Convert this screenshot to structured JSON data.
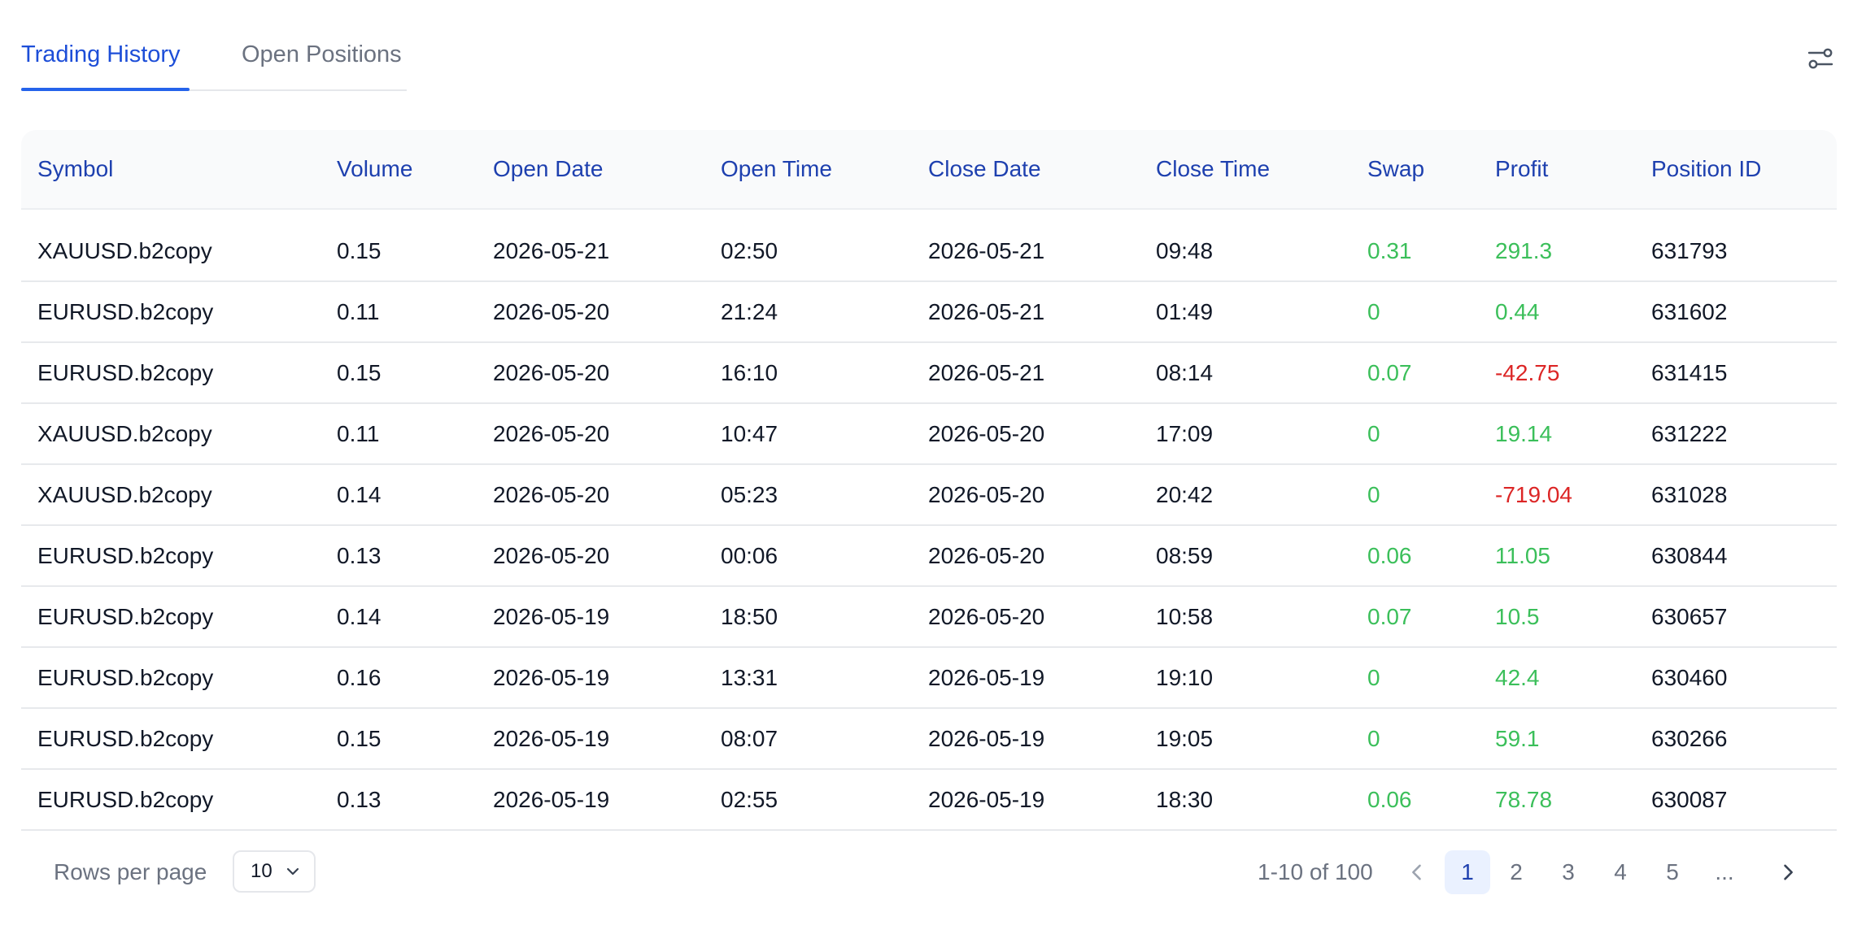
{
  "tabs": [
    {
      "label": "Trading History",
      "active": true
    },
    {
      "label": "Open Positions",
      "active": false
    }
  ],
  "settings_icon": "sliders-settings-icon",
  "table": {
    "headers": [
      "Symbol",
      "Volume",
      "Open Date",
      "Open Time",
      "Close Date",
      "Close Time",
      "Swap",
      "Profit",
      "Position ID"
    ],
    "rows": [
      [
        "XAUUSD.b2copy",
        "0.15",
        "2026-05-21",
        "02:50",
        "2026-05-21",
        "09:48",
        "0.31",
        "291.3",
        "631793"
      ],
      [
        "EURUSD.b2copy",
        "0.11",
        "2026-05-20",
        "21:24",
        "2026-05-21",
        "01:49",
        "0",
        "0.44",
        "631602"
      ],
      [
        "EURUSD.b2copy",
        "0.15",
        "2026-05-20",
        "16:10",
        "2026-05-21",
        "08:14",
        "0.07",
        "-42.75",
        "631415"
      ],
      [
        "XAUUSD.b2copy",
        "0.11",
        "2026-05-20",
        "10:47",
        "2026-05-20",
        "17:09",
        "0",
        "19.14",
        "631222"
      ],
      [
        "XAUUSD.b2copy",
        "0.14",
        "2026-05-20",
        "05:23",
        "2026-05-20",
        "20:42",
        "0",
        "-719.04",
        "631028"
      ],
      [
        "EURUSD.b2copy",
        "0.13",
        "2026-05-20",
        "00:06",
        "2026-05-20",
        "08:59",
        "0.06",
        "11.05",
        "630844"
      ],
      [
        "EURUSD.b2copy",
        "0.14",
        "2026-05-19",
        "18:50",
        "2026-05-20",
        "10:58",
        "0.07",
        "10.5",
        "630657"
      ],
      [
        "EURUSD.b2copy",
        "0.16",
        "2026-05-19",
        "13:31",
        "2026-05-19",
        "19:10",
        "0",
        "42.4",
        "630460"
      ],
      [
        "EURUSD.b2copy",
        "0.15",
        "2026-05-19",
        "08:07",
        "2026-05-19",
        "19:05",
        "0",
        "59.1",
        "630266"
      ],
      [
        "EURUSD.b2copy",
        "0.13",
        "2026-05-19",
        "02:55",
        "2026-05-19",
        "18:30",
        "0.06",
        "78.78",
        "630087"
      ]
    ]
  },
  "footer": {
    "rows_per_page_label": "Rows per page",
    "rows_per_page_value": "10",
    "range_text": "1-10 of 100",
    "pages": [
      "1",
      "2",
      "3",
      "4",
      "5",
      "..."
    ],
    "current_page": "1"
  },
  "colors": {
    "accent": "#2563eb",
    "header_text": "#1e40af",
    "positive": "#3bbf5a",
    "negative": "#dc2626"
  }
}
